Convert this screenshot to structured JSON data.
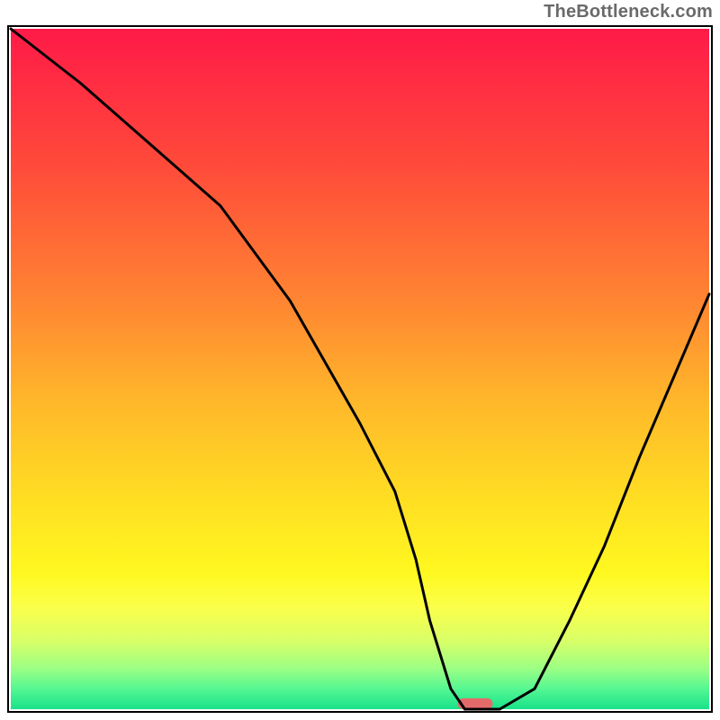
{
  "watermark": "TheBottleneck.com",
  "chart_data": {
    "type": "line",
    "title": "",
    "xlabel": "",
    "ylabel": "",
    "xlim": [
      0,
      100
    ],
    "ylim": [
      0,
      100
    ],
    "x": [
      0,
      10,
      20,
      30,
      40,
      50,
      55,
      58,
      60,
      63,
      65,
      68,
      70,
      75,
      80,
      85,
      90,
      95,
      100
    ],
    "values": [
      100,
      92,
      83,
      74,
      60,
      42,
      32,
      22,
      13,
      3,
      0,
      0,
      0,
      3,
      13,
      24,
      37,
      49,
      61
    ],
    "gradient_stops": [
      {
        "p": 0.0,
        "c": "#ff1a48"
      },
      {
        "p": 0.2,
        "c": "#ff4a3a"
      },
      {
        "p": 0.4,
        "c": "#ff8532"
      },
      {
        "p": 0.55,
        "c": "#ffb82a"
      },
      {
        "p": 0.7,
        "c": "#ffe022"
      },
      {
        "p": 0.8,
        "c": "#fff820"
      },
      {
        "p": 0.85,
        "c": "#fbff4a"
      },
      {
        "p": 0.9,
        "c": "#d8ff68"
      },
      {
        "p": 0.94,
        "c": "#9cff84"
      },
      {
        "p": 0.97,
        "c": "#55f792"
      },
      {
        "p": 1.0,
        "c": "#18e28a"
      }
    ],
    "marker": {
      "x": 66.5,
      "y": 0,
      "w": 5,
      "h": 1.6,
      "color": "#e46a6a"
    }
  }
}
